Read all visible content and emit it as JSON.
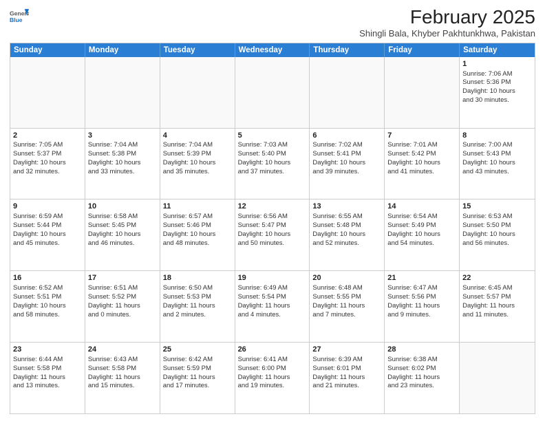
{
  "header": {
    "logo_general": "General",
    "logo_blue": "Blue",
    "title": "February 2025",
    "subtitle": "Shingli Bala, Khyber Pakhtunkhwa, Pakistan"
  },
  "days_of_week": [
    "Sunday",
    "Monday",
    "Tuesday",
    "Wednesday",
    "Thursday",
    "Friday",
    "Saturday"
  ],
  "weeks": [
    [
      {
        "day": "",
        "empty": true,
        "lines": []
      },
      {
        "day": "",
        "empty": true,
        "lines": []
      },
      {
        "day": "",
        "empty": true,
        "lines": []
      },
      {
        "day": "",
        "empty": true,
        "lines": []
      },
      {
        "day": "",
        "empty": true,
        "lines": []
      },
      {
        "day": "",
        "empty": true,
        "lines": []
      },
      {
        "day": "1",
        "empty": false,
        "lines": [
          "Sunrise: 7:06 AM",
          "Sunset: 5:36 PM",
          "Daylight: 10 hours",
          "and 30 minutes."
        ]
      }
    ],
    [
      {
        "day": "2",
        "empty": false,
        "lines": [
          "Sunrise: 7:05 AM",
          "Sunset: 5:37 PM",
          "Daylight: 10 hours",
          "and 32 minutes."
        ]
      },
      {
        "day": "3",
        "empty": false,
        "lines": [
          "Sunrise: 7:04 AM",
          "Sunset: 5:38 PM",
          "Daylight: 10 hours",
          "and 33 minutes."
        ]
      },
      {
        "day": "4",
        "empty": false,
        "lines": [
          "Sunrise: 7:04 AM",
          "Sunset: 5:39 PM",
          "Daylight: 10 hours",
          "and 35 minutes."
        ]
      },
      {
        "day": "5",
        "empty": false,
        "lines": [
          "Sunrise: 7:03 AM",
          "Sunset: 5:40 PM",
          "Daylight: 10 hours",
          "and 37 minutes."
        ]
      },
      {
        "day": "6",
        "empty": false,
        "lines": [
          "Sunrise: 7:02 AM",
          "Sunset: 5:41 PM",
          "Daylight: 10 hours",
          "and 39 minutes."
        ]
      },
      {
        "day": "7",
        "empty": false,
        "lines": [
          "Sunrise: 7:01 AM",
          "Sunset: 5:42 PM",
          "Daylight: 10 hours",
          "and 41 minutes."
        ]
      },
      {
        "day": "8",
        "empty": false,
        "lines": [
          "Sunrise: 7:00 AM",
          "Sunset: 5:43 PM",
          "Daylight: 10 hours",
          "and 43 minutes."
        ]
      }
    ],
    [
      {
        "day": "9",
        "empty": false,
        "lines": [
          "Sunrise: 6:59 AM",
          "Sunset: 5:44 PM",
          "Daylight: 10 hours",
          "and 45 minutes."
        ]
      },
      {
        "day": "10",
        "empty": false,
        "lines": [
          "Sunrise: 6:58 AM",
          "Sunset: 5:45 PM",
          "Daylight: 10 hours",
          "and 46 minutes."
        ]
      },
      {
        "day": "11",
        "empty": false,
        "lines": [
          "Sunrise: 6:57 AM",
          "Sunset: 5:46 PM",
          "Daylight: 10 hours",
          "and 48 minutes."
        ]
      },
      {
        "day": "12",
        "empty": false,
        "lines": [
          "Sunrise: 6:56 AM",
          "Sunset: 5:47 PM",
          "Daylight: 10 hours",
          "and 50 minutes."
        ]
      },
      {
        "day": "13",
        "empty": false,
        "lines": [
          "Sunrise: 6:55 AM",
          "Sunset: 5:48 PM",
          "Daylight: 10 hours",
          "and 52 minutes."
        ]
      },
      {
        "day": "14",
        "empty": false,
        "lines": [
          "Sunrise: 6:54 AM",
          "Sunset: 5:49 PM",
          "Daylight: 10 hours",
          "and 54 minutes."
        ]
      },
      {
        "day": "15",
        "empty": false,
        "lines": [
          "Sunrise: 6:53 AM",
          "Sunset: 5:50 PM",
          "Daylight: 10 hours",
          "and 56 minutes."
        ]
      }
    ],
    [
      {
        "day": "16",
        "empty": false,
        "lines": [
          "Sunrise: 6:52 AM",
          "Sunset: 5:51 PM",
          "Daylight: 10 hours",
          "and 58 minutes."
        ]
      },
      {
        "day": "17",
        "empty": false,
        "lines": [
          "Sunrise: 6:51 AM",
          "Sunset: 5:52 PM",
          "Daylight: 11 hours",
          "and 0 minutes."
        ]
      },
      {
        "day": "18",
        "empty": false,
        "lines": [
          "Sunrise: 6:50 AM",
          "Sunset: 5:53 PM",
          "Daylight: 11 hours",
          "and 2 minutes."
        ]
      },
      {
        "day": "19",
        "empty": false,
        "lines": [
          "Sunrise: 6:49 AM",
          "Sunset: 5:54 PM",
          "Daylight: 11 hours",
          "and 4 minutes."
        ]
      },
      {
        "day": "20",
        "empty": false,
        "lines": [
          "Sunrise: 6:48 AM",
          "Sunset: 5:55 PM",
          "Daylight: 11 hours",
          "and 7 minutes."
        ]
      },
      {
        "day": "21",
        "empty": false,
        "lines": [
          "Sunrise: 6:47 AM",
          "Sunset: 5:56 PM",
          "Daylight: 11 hours",
          "and 9 minutes."
        ]
      },
      {
        "day": "22",
        "empty": false,
        "lines": [
          "Sunrise: 6:45 AM",
          "Sunset: 5:57 PM",
          "Daylight: 11 hours",
          "and 11 minutes."
        ]
      }
    ],
    [
      {
        "day": "23",
        "empty": false,
        "lines": [
          "Sunrise: 6:44 AM",
          "Sunset: 5:58 PM",
          "Daylight: 11 hours",
          "and 13 minutes."
        ]
      },
      {
        "day": "24",
        "empty": false,
        "lines": [
          "Sunrise: 6:43 AM",
          "Sunset: 5:58 PM",
          "Daylight: 11 hours",
          "and 15 minutes."
        ]
      },
      {
        "day": "25",
        "empty": false,
        "lines": [
          "Sunrise: 6:42 AM",
          "Sunset: 5:59 PM",
          "Daylight: 11 hours",
          "and 17 minutes."
        ]
      },
      {
        "day": "26",
        "empty": false,
        "lines": [
          "Sunrise: 6:41 AM",
          "Sunset: 6:00 PM",
          "Daylight: 11 hours",
          "and 19 minutes."
        ]
      },
      {
        "day": "27",
        "empty": false,
        "lines": [
          "Sunrise: 6:39 AM",
          "Sunset: 6:01 PM",
          "Daylight: 11 hours",
          "and 21 minutes."
        ]
      },
      {
        "day": "28",
        "empty": false,
        "lines": [
          "Sunrise: 6:38 AM",
          "Sunset: 6:02 PM",
          "Daylight: 11 hours",
          "and 23 minutes."
        ]
      },
      {
        "day": "",
        "empty": true,
        "lines": []
      }
    ]
  ]
}
